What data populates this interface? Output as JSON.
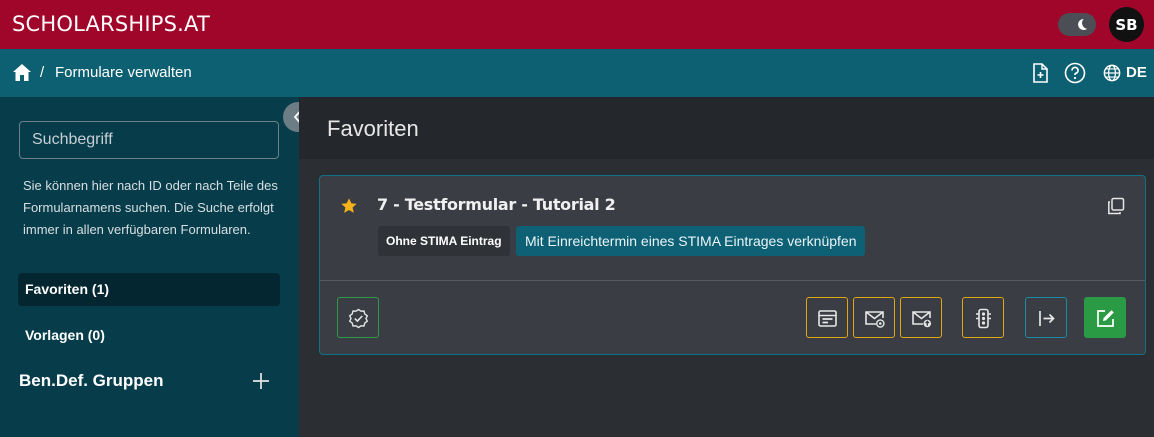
{
  "app": {
    "brand": "SCHOLARSHIPS.AT",
    "user_initials": "SB",
    "language": "DE"
  },
  "breadcrumb": {
    "separator": "/",
    "page": "Formulare verwalten"
  },
  "sidebar": {
    "search_placeholder": "Suchbegriff",
    "hint": "Sie können hier nach ID oder nach Teile des Formularnamens suchen. Die Suche erfolgt immer in allen verfügbaren Formularen.",
    "items": [
      {
        "label": "Favoriten (1)",
        "active": true
      },
      {
        "label": "Vorlagen (0)",
        "active": false
      }
    ],
    "groups_title": "Ben.Def. Gruppen"
  },
  "main": {
    "title": "Favoriten",
    "card": {
      "title": "7 - Testformular - Tutorial 2",
      "badge_plain": "Ohne STIMA Eintrag",
      "badge_link": "Mit Einreichtermin eines STIMA Eintrages verknüpfen"
    }
  },
  "colors": {
    "topbar": "#a0062a",
    "subbar": "#0d5f72",
    "sidebar": "#073d4a",
    "accent_yellow": "#e1a713",
    "accent_green": "#2b9a45",
    "star": "#f5b21b"
  },
  "icons": [
    "moon-icon",
    "home-icon",
    "new-form-icon",
    "help-icon",
    "globe-icon",
    "plus-icon",
    "chevron-left-icon",
    "star-icon",
    "copy-icon",
    "badge-check-icon",
    "calendar-list-icon",
    "mail-at-icon",
    "mail-upload-icon",
    "traffic-light-icon",
    "export-icon",
    "edit-icon"
  ]
}
